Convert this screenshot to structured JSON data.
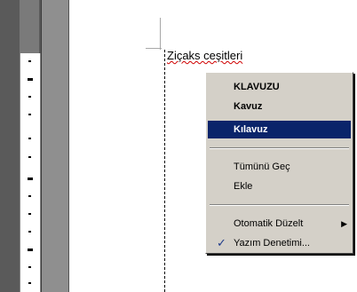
{
  "document": {
    "text": "Ziçaks ceşitleri"
  },
  "context_menu": {
    "items": [
      {
        "label": "KLAVUZU"
      },
      {
        "label": "Kavuz"
      },
      {
        "label": "Kılavuz"
      },
      {
        "label": "Tümünü Geç"
      },
      {
        "label": "Ekle"
      },
      {
        "label": "Otomatik Düzelt"
      },
      {
        "label": "Yazım Denetimi..."
      }
    ]
  }
}
